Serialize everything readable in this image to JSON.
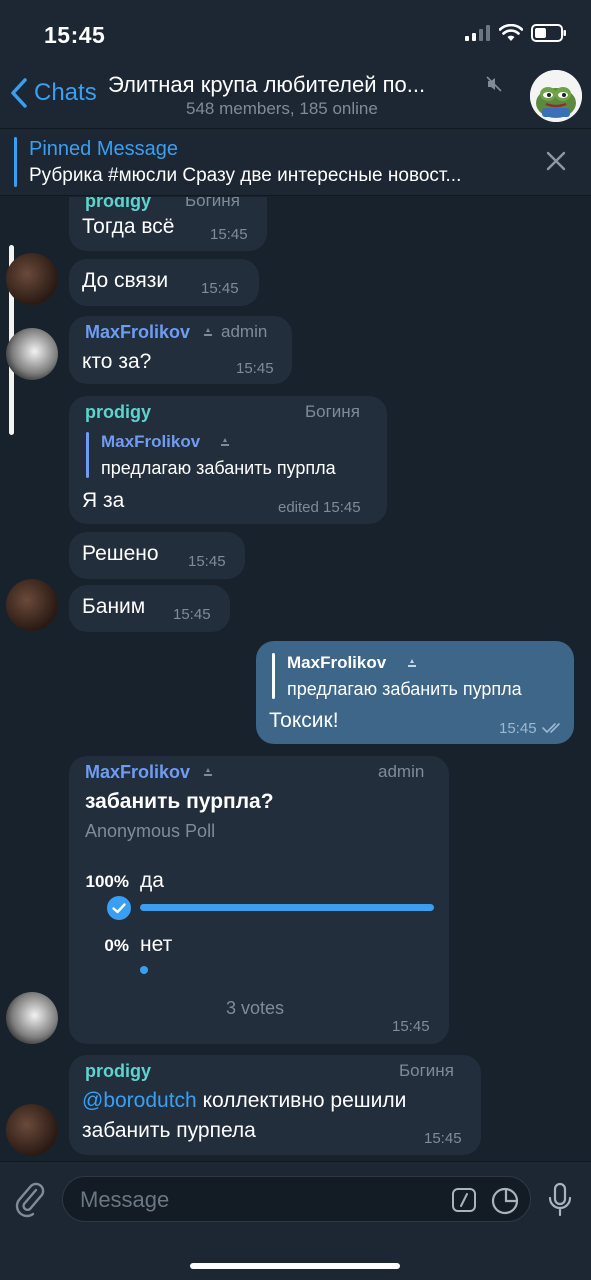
{
  "status_bar": {
    "time": "15:45"
  },
  "header": {
    "back_label": "Chats",
    "title": "Элитная крупа любителей по...",
    "subtitle": "548 members, 185 online"
  },
  "pinned": {
    "title": "Pinned Message",
    "text": "Рубрика #мюсли Сразу две интересные новост..."
  },
  "messages": [
    {
      "sender": "prodigy",
      "role": "Богиня",
      "text": "Тогда всё",
      "time": "15:45"
    },
    {
      "text": "До связи",
      "time": "15:45"
    },
    {
      "sender": "MaxFrolikov",
      "role": "admin",
      "text": "кто за?",
      "time": "15:45"
    },
    {
      "sender": "prodigy",
      "role": "Богиня",
      "reply_name": "MaxFrolikov",
      "reply_text": "предлагаю забанить пурпла",
      "text": "Я за",
      "time": "edited 15:45"
    },
    {
      "text": "Решено",
      "time": "15:45"
    },
    {
      "text": "Баним",
      "time": "15:45"
    },
    {
      "reply_name": "MaxFrolikov",
      "reply_text": "предлагаю забанить пурпла",
      "text": "Токсик!",
      "time": "15:45"
    },
    {
      "text_mention": "@borodutch",
      "sender": "prodigy",
      "role": "Богиня",
      "text_line1": " коллективно решили",
      "text_line2": "забанить пурпела",
      "time": "15:45"
    }
  ],
  "poll": {
    "sender": "MaxFrolikov",
    "role": "admin",
    "question": "забанить пурпла?",
    "type": "Anonymous Poll",
    "options": [
      {
        "pct": "100%",
        "label": "да",
        "fraction": 1.0
      },
      {
        "pct": "0%",
        "label": "нет",
        "fraction": 0.0
      }
    ],
    "votes": "3 votes",
    "time": "15:45"
  },
  "input": {
    "placeholder": "Message"
  },
  "colors": {
    "accent": "#3a9ff2",
    "prodigy_name": "#5fd4cf",
    "max_name": "#6f9cf2",
    "bubble_in": "#232e3c",
    "bubble_out": "#3d6689"
  }
}
